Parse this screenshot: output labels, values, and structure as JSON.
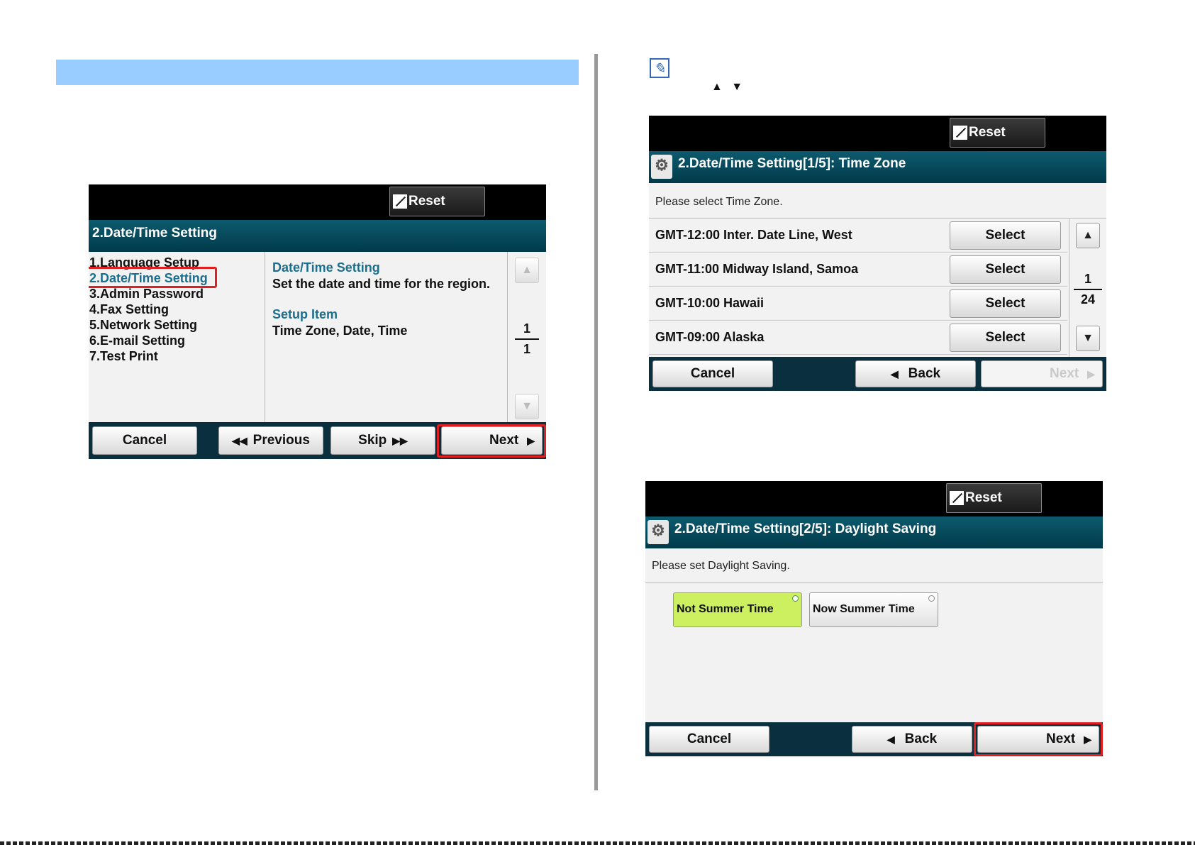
{
  "note_arrows": "▲ ▼",
  "panel1": {
    "reset": "Reset",
    "title": "2.Date/Time Setting",
    "menu": [
      "1.Language Setup",
      "2.Date/Time Setting",
      "3.Admin Password",
      "4.Fax Setting",
      "5.Network Setting",
      "6.E-mail Setting",
      "7.Test Print"
    ],
    "selected_index": 1,
    "info_heading1": "Date/Time Setting",
    "info_text1": "Set the date and time for the region.",
    "info_heading2": "Setup Item",
    "info_text2": "Time Zone, Date, Time",
    "page_current": "1",
    "page_total": "1",
    "buttons": {
      "cancel": "Cancel",
      "previous": "Previous",
      "skip": "Skip",
      "next": "Next"
    }
  },
  "panel2": {
    "reset": "Reset",
    "title": "2.Date/Time Setting[1/5]: Time Zone",
    "prompt": "Please select Time Zone.",
    "zones": [
      "GMT-12:00 Inter. Date Line, West",
      "GMT-11:00 Midway Island, Samoa",
      "GMT-10:00 Hawaii",
      "GMT-09:00 Alaska"
    ],
    "select_label": "Select",
    "page_current": "1",
    "page_total": "24",
    "buttons": {
      "cancel": "Cancel",
      "back": "Back",
      "next": "Next"
    }
  },
  "panel3": {
    "reset": "Reset",
    "title": "2.Date/Time Setting[2/5]: Daylight Saving",
    "prompt": "Please set Daylight Saving.",
    "options": [
      "Not Summer Time",
      "Now Summer Time"
    ],
    "selected_option": "Not Summer Time",
    "buttons": {
      "cancel": "Cancel",
      "back": "Back",
      "next": "Next"
    }
  },
  "colors": {
    "header_band": "#99ccff",
    "title_bar": "#0d5a6e",
    "highlight": "#e02020",
    "accent_text": "#1b6e8c",
    "option_selected": "#ccf060"
  }
}
